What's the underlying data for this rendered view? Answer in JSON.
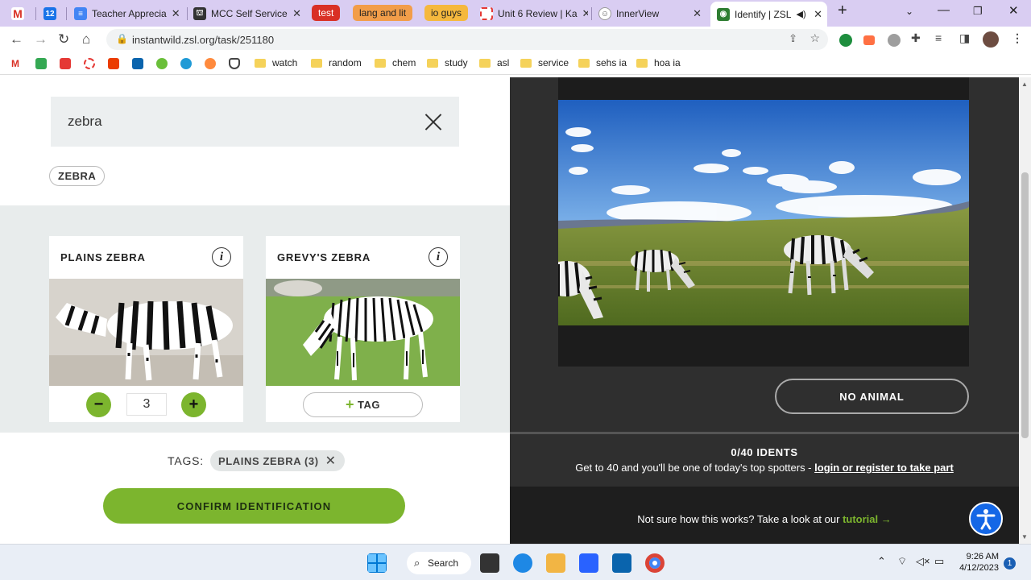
{
  "browser": {
    "tabs": [
      {
        "label": "",
        "favicon": "gmail-icon"
      },
      {
        "label": "",
        "favicon": "calendar-icon"
      },
      {
        "label": "Teacher Apprecia",
        "favicon": "docs-icon"
      },
      {
        "label": "MCC Self Service",
        "favicon": "mcc-icon"
      },
      {
        "label": "test",
        "favicon": ""
      },
      {
        "label": "lang and lit",
        "favicon": ""
      },
      {
        "label": "io guys",
        "favicon": ""
      },
      {
        "label": "Unit 6 Review | Ka",
        "favicon": "kahoot-icon"
      },
      {
        "label": "InnerView",
        "favicon": "innerview-icon"
      },
      {
        "label": "Identify | ZSL",
        "favicon": "zsl-icon"
      }
    ],
    "url": "instantwild.zsl.org/task/251180",
    "bookmarks": [
      "watch",
      "random",
      "chem",
      "study",
      "asl",
      "service",
      "sehs ia",
      "hoa ia"
    ]
  },
  "search": {
    "value": "zebra",
    "chip": "ZEBRA"
  },
  "results": [
    {
      "title": "PLAINS ZEBRA",
      "count": "3"
    },
    {
      "title": "GREVY'S ZEBRA",
      "tag_label": "TAG"
    }
  ],
  "tags": {
    "label": "TAGS:",
    "items": [
      "PLAINS ZEBRA (3)"
    ]
  },
  "confirm_label": "CONFIRM IDENTIFICATION",
  "no_animal_label": "NO ANIMAL",
  "progress": {
    "idents": "0/40 IDENTS",
    "message": "Get to 40 and you'll be one of today's top spotters - ",
    "link": "login or register to take part"
  },
  "help": {
    "text": "Not sure how this works? Take a look at our ",
    "link": "tutorial"
  },
  "taskbar": {
    "search": "Search",
    "time": "9:26 AM",
    "date": "4/12/2023",
    "notifications": "1"
  },
  "colors": {
    "accent_green": "#7cb52e",
    "chrome_purple": "#d9cdf2",
    "dark_panel": "#2f2f2f"
  }
}
